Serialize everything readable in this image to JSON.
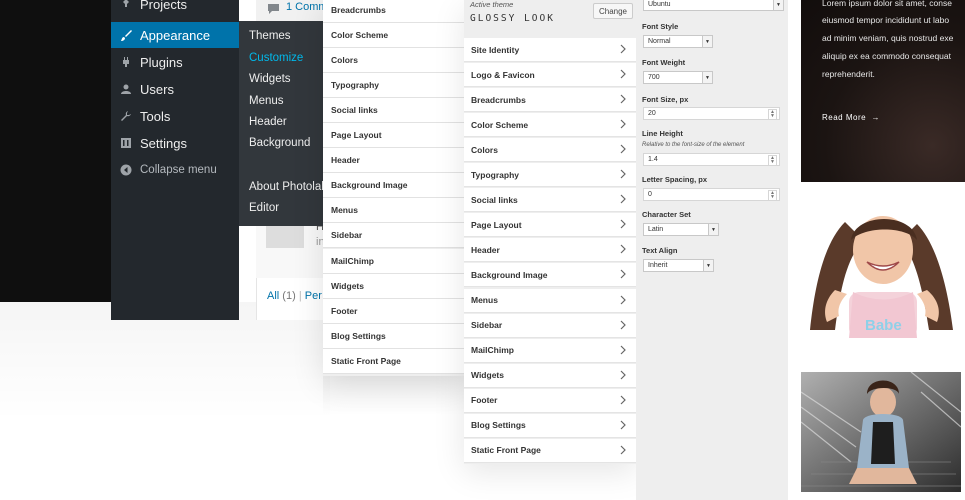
{
  "wp_menu": {
    "items": [
      {
        "label": "Projects",
        "icon": "pin-icon"
      },
      {
        "label": "Appearance",
        "icon": "brush-icon",
        "active": true
      },
      {
        "label": "Plugins",
        "icon": "plug-icon"
      },
      {
        "label": "Users",
        "icon": "user-icon"
      },
      {
        "label": "Tools",
        "icon": "wrench-icon"
      },
      {
        "label": "Settings",
        "icon": "settings-icon"
      }
    ],
    "collapse_label": "Collapse menu",
    "submenu": {
      "themes": "Themes",
      "customize": "Customize",
      "widgets": "Widgets",
      "menus": "Menus",
      "header": "Header",
      "background": "Background",
      "about": "About Photolab",
      "editor": "Editor"
    }
  },
  "comments": {
    "top_link": "1 Comm",
    "snippet_1": "H",
    "snippet_2": "in",
    "filter_all": "All",
    "filter_count": "(1)",
    "filter_sep": "|",
    "filter_next": "Per"
  },
  "customizer_left": {
    "sections": [
      "Breadcrumbs",
      "Color Scheme",
      "Colors",
      "Typography",
      "Social links",
      "Page Layout",
      "Header",
      "Background Image",
      "Menus",
      "Sidebar",
      "MailChimp",
      "Widgets",
      "Footer",
      "Blog Settings",
      "Static Front Page"
    ]
  },
  "customizer_main": {
    "active_theme_label": "Active theme",
    "theme_name": "GLOSSY LOOK",
    "change_label": "Change",
    "sections": [
      "Site Identity",
      "Logo & Favicon",
      "Breadcrumbs",
      "Color Scheme",
      "Colors",
      "Typography",
      "Social links",
      "Page Layout",
      "Header",
      "Background Image",
      "Menus",
      "Sidebar",
      "MailChimp",
      "Widgets",
      "Footer",
      "Blog Settings",
      "Static Front Page"
    ]
  },
  "typography": {
    "font_family_value": "Ubuntu",
    "font_style_label": "Font Style",
    "font_style_value": "Normal",
    "font_weight_label": "Font Weight",
    "font_weight_value": "700",
    "font_size_label": "Font Size, px",
    "font_size_value": "20",
    "line_height_label": "Line Height",
    "line_height_desc": "Relative to the font-size of the element",
    "line_height_value": "1.4",
    "letter_spacing_label": "Letter Spacing, px",
    "letter_spacing_value": "0",
    "charset_label": "Character Set",
    "charset_value": "Latin",
    "text_align_label": "Text Align",
    "text_align_value": "Inherit"
  },
  "preview": {
    "lines": [
      "Lorem ipsum dolor sit amet, conse",
      "eiusmod tempor incididunt ut labo",
      "ad minim veniam, quis nostrud exe",
      "aliquip ex ea commodo consequat",
      "reprehenderit."
    ],
    "read_more": "Read More",
    "shirt_text": "Babe"
  }
}
